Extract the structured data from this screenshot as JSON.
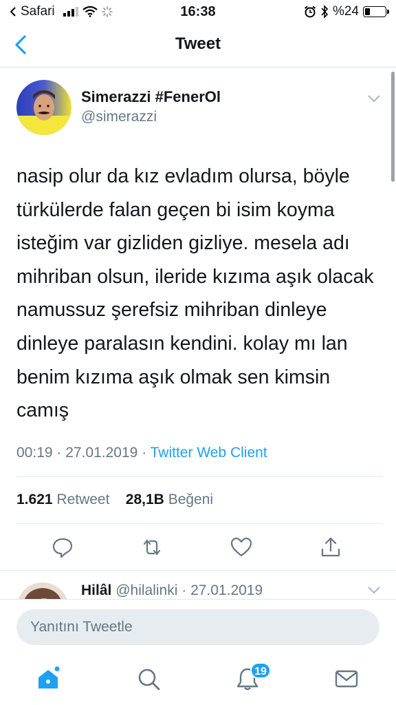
{
  "status_bar": {
    "carrier": "Safari",
    "time": "16:38",
    "battery_text": "%24",
    "battery_level": 0.24
  },
  "nav": {
    "title": "Tweet"
  },
  "tweet": {
    "author_name": "Simerazzi #FenerOl",
    "author_handle": "@simerazzi",
    "text": "nasip olur da kız evladım olursa, böyle türkülerde falan geçen bi isim koyma isteğim var gizliden gizliye. mesela adı mihriban olsun, ileride kızıma aşık olacak namussuz şerefsiz mihriban dinleye dinleye paralasın kendini. kolay mı lan benim kızıma aşık olmak sen kimsin camış",
    "time": "00:19",
    "date": "27.01.2019",
    "client": "Twitter Web Client",
    "retweet_count": "1.621",
    "retweet_label": "Retweet",
    "like_count": "28,1B",
    "like_label": "Beğeni"
  },
  "reply_preview": {
    "name": "Hilâl",
    "handle": "@hilalinki",
    "date": "27.01.2019"
  },
  "composer": {
    "placeholder": "Yanıtını Tweetle"
  },
  "tabbar": {
    "notification_badge": "19"
  },
  "colors": {
    "accent": "#1da1f2",
    "secondary_text": "#657786",
    "divider": "#e1e8ed"
  }
}
